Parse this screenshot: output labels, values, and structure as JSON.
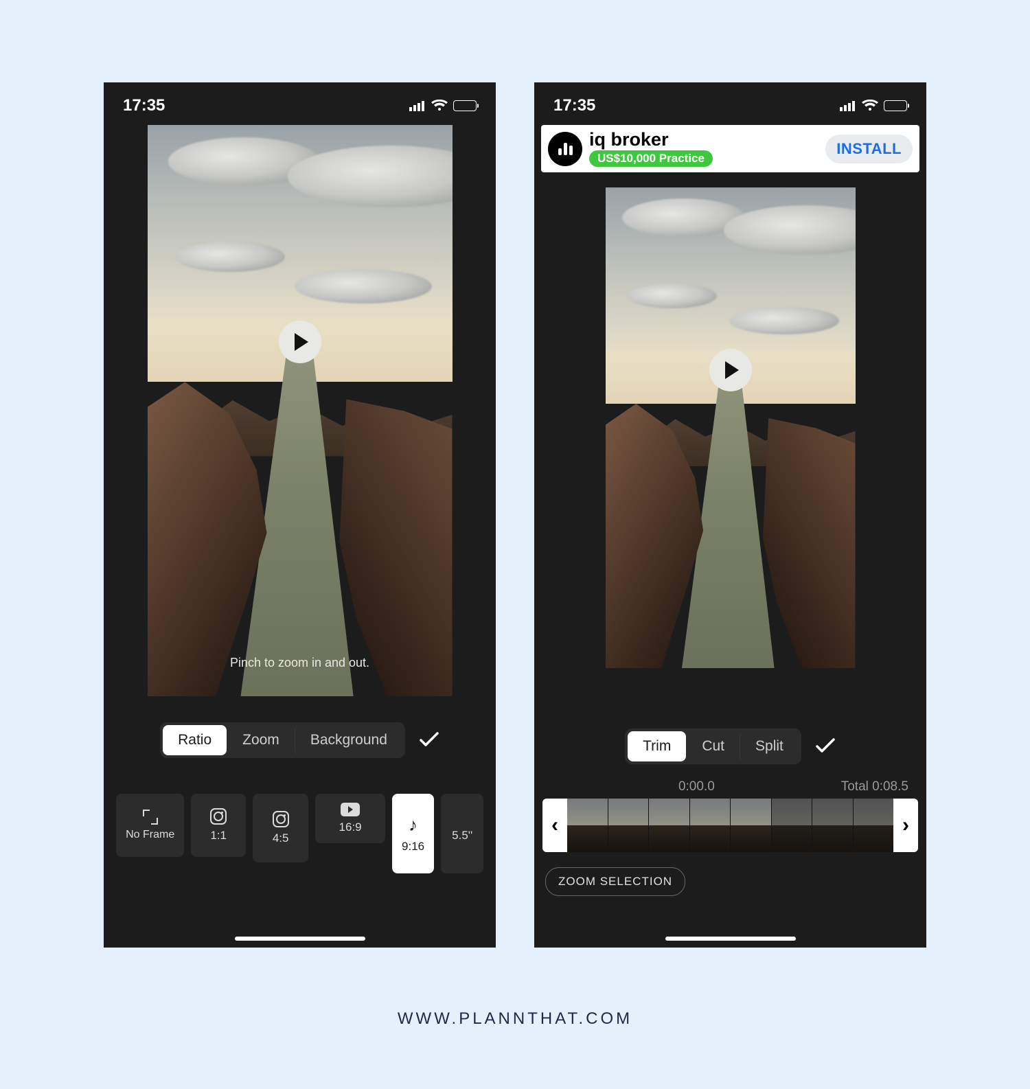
{
  "status": {
    "time": "17:35"
  },
  "footer": "WWW.PLANNTHAT.COM",
  "left": {
    "hint": "Pinch to zoom in and out.",
    "tabs": [
      {
        "label": "Ratio",
        "active": true
      },
      {
        "label": "Zoom",
        "active": false
      },
      {
        "label": "Background",
        "active": false
      }
    ],
    "ratios": [
      {
        "label": "No Frame",
        "icon": "noframe"
      },
      {
        "label": "1:1",
        "icon": "instagram"
      },
      {
        "label": "4:5",
        "icon": "instagram"
      },
      {
        "label": "16:9",
        "icon": "youtube"
      },
      {
        "label": "9:16",
        "icon": "tiktok",
        "selected": true
      },
      {
        "label": "5.5''",
        "icon": "apple"
      }
    ]
  },
  "right": {
    "ad": {
      "title": "iq broker",
      "subtitle": "US$10,000 Practice",
      "cta": "INSTALL"
    },
    "tabs": [
      {
        "label": "Trim",
        "active": true
      },
      {
        "label": "Cut",
        "active": false
      },
      {
        "label": "Split",
        "active": false
      }
    ],
    "time": {
      "current": "0:00.0",
      "total_label": "Total 0:08.5"
    },
    "zoom_selection": "ZOOM SELECTION"
  }
}
